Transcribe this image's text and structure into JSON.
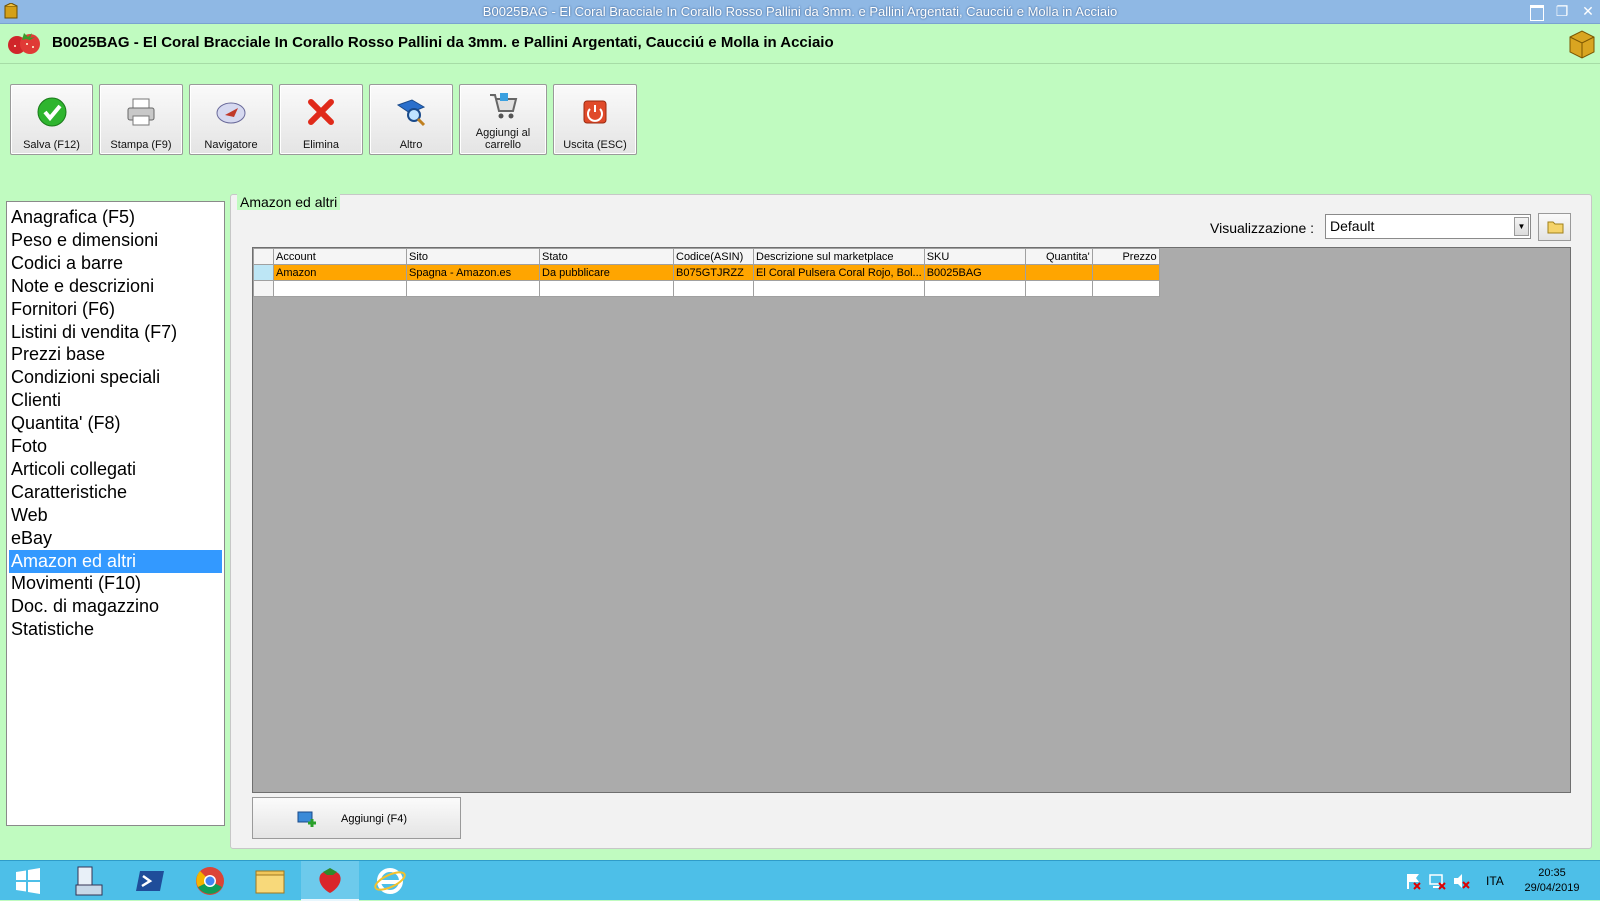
{
  "window": {
    "title": "B0025BAG - El Coral Bracciale In Corallo Rosso Pallini da 3mm. e Pallini Argentati, Caucciú e Molla in Acciaio",
    "close_glyph": "✕",
    "restore_glyph": "❐"
  },
  "header": {
    "title": "B0025BAG - El Coral Bracciale In Corallo Rosso Pallini da 3mm. e Pallini Argentati, Caucciú e Molla in Acciaio"
  },
  "toolbar": {
    "buttons": [
      {
        "label": "Salva (F12)",
        "icon": "checkmark-icon"
      },
      {
        "label": "Stampa (F9)",
        "icon": "printer-icon"
      },
      {
        "label": "Navigatore",
        "icon": "compass-icon"
      },
      {
        "label": "Elimina",
        "icon": "red-x-icon"
      },
      {
        "label": "Altro",
        "icon": "magnifier-book-icon"
      },
      {
        "label": "Aggiungi al carrello",
        "icon": "cart-icon"
      },
      {
        "label": "Uscita (ESC)",
        "icon": "power-icon"
      }
    ]
  },
  "nav": {
    "selected": "Amazon ed altri",
    "items": [
      "Anagrafica (F5)",
      "Peso e dimensioni",
      "Codici a barre",
      "Note e descrizioni",
      "Fornitori (F6)",
      "Listini di vendita (F7)",
      "Prezzi base",
      "Condizioni speciali",
      "Clienti",
      "Quantita' (F8)",
      "Foto",
      "Articoli collegati",
      "Caratteristiche",
      "Web",
      "eBay",
      "Amazon ed altri",
      "Movimenti (F10)",
      "Doc. di magazzino",
      "Statistiche"
    ]
  },
  "panel": {
    "title": "Amazon ed altri",
    "view_label": "Visualizzazione :",
    "view_value": "Default",
    "dropdown_glyph": "▼"
  },
  "grid": {
    "columns": [
      "Account",
      "Sito",
      "Stato",
      "Codice(ASIN)",
      "Descrizione sul marketplace",
      "SKU",
      "Quantita'",
      "Prezzo"
    ],
    "rows": [
      [
        "Amazon",
        "Spagna - Amazon.es",
        "Da pubblicare",
        "B075GTJRZZ",
        "El Coral Pulsera Coral Rojo, Bol...",
        "B0025BAG",
        "",
        ""
      ]
    ]
  },
  "add_button": {
    "label": "Aggiungi (F4)"
  },
  "taskbar": {
    "language": "ITA",
    "time": "20:35",
    "date": "29/04/2019"
  },
  "colors": {
    "app_background": "#c0fbc0",
    "selection_blue": "#3399ff",
    "row_highlight": "#ffa500",
    "taskbar": "#4dbfe8"
  }
}
